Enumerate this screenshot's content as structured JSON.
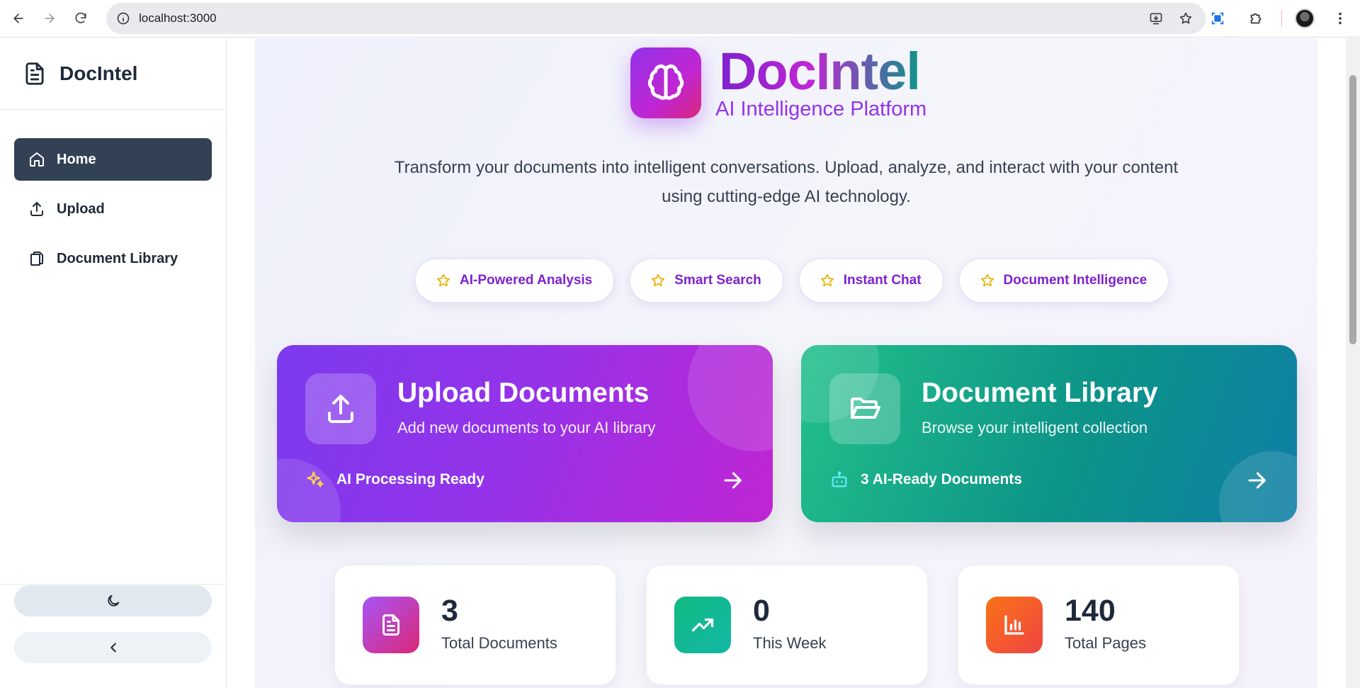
{
  "browser": {
    "url": "localhost:3000"
  },
  "sidebar": {
    "brand": "DocIntel",
    "items": [
      {
        "label": "Home",
        "icon": "home-icon",
        "active": true
      },
      {
        "label": "Upload",
        "icon": "upload-icon",
        "active": false
      },
      {
        "label": "Document Library",
        "icon": "copy-icon",
        "active": false
      }
    ],
    "theme_icon": "moon-icon",
    "collapse_icon": "chevron-left-icon"
  },
  "hero": {
    "title": "DocIntel",
    "subtitle": "AI Intelligence Platform",
    "tagline": "Transform your documents into intelligent conversations. Upload, analyze, and interact with your content using cutting-edge AI technology."
  },
  "features": [
    {
      "label": "AI-Powered Analysis",
      "icon": "star-icon"
    },
    {
      "label": "Smart Search",
      "icon": "star-icon"
    },
    {
      "label": "Instant Chat",
      "icon": "star-icon"
    },
    {
      "label": "Document Intelligence",
      "icon": "star-icon"
    }
  ],
  "cards": {
    "upload": {
      "title": "Upload Documents",
      "subtitle": "Add new documents to your AI library",
      "footer": "AI Processing Ready",
      "color_start": "#7c3aed",
      "color_end": "#c026d3"
    },
    "library": {
      "title": "Document Library",
      "subtitle": "Browse your intelligent collection",
      "footer": "3 AI-Ready Documents",
      "color_start": "#22c08a",
      "color_end": "#0e7ea6"
    }
  },
  "stats": [
    {
      "value": "3",
      "label": "Total Documents",
      "icon": "file-text-icon",
      "color": "#c026d3"
    },
    {
      "value": "0",
      "label": "This Week",
      "icon": "trending-up-icon",
      "color": "#10b981"
    },
    {
      "value": "140",
      "label": "Total Pages",
      "icon": "bar-chart-icon",
      "color": "#f97316"
    }
  ]
}
